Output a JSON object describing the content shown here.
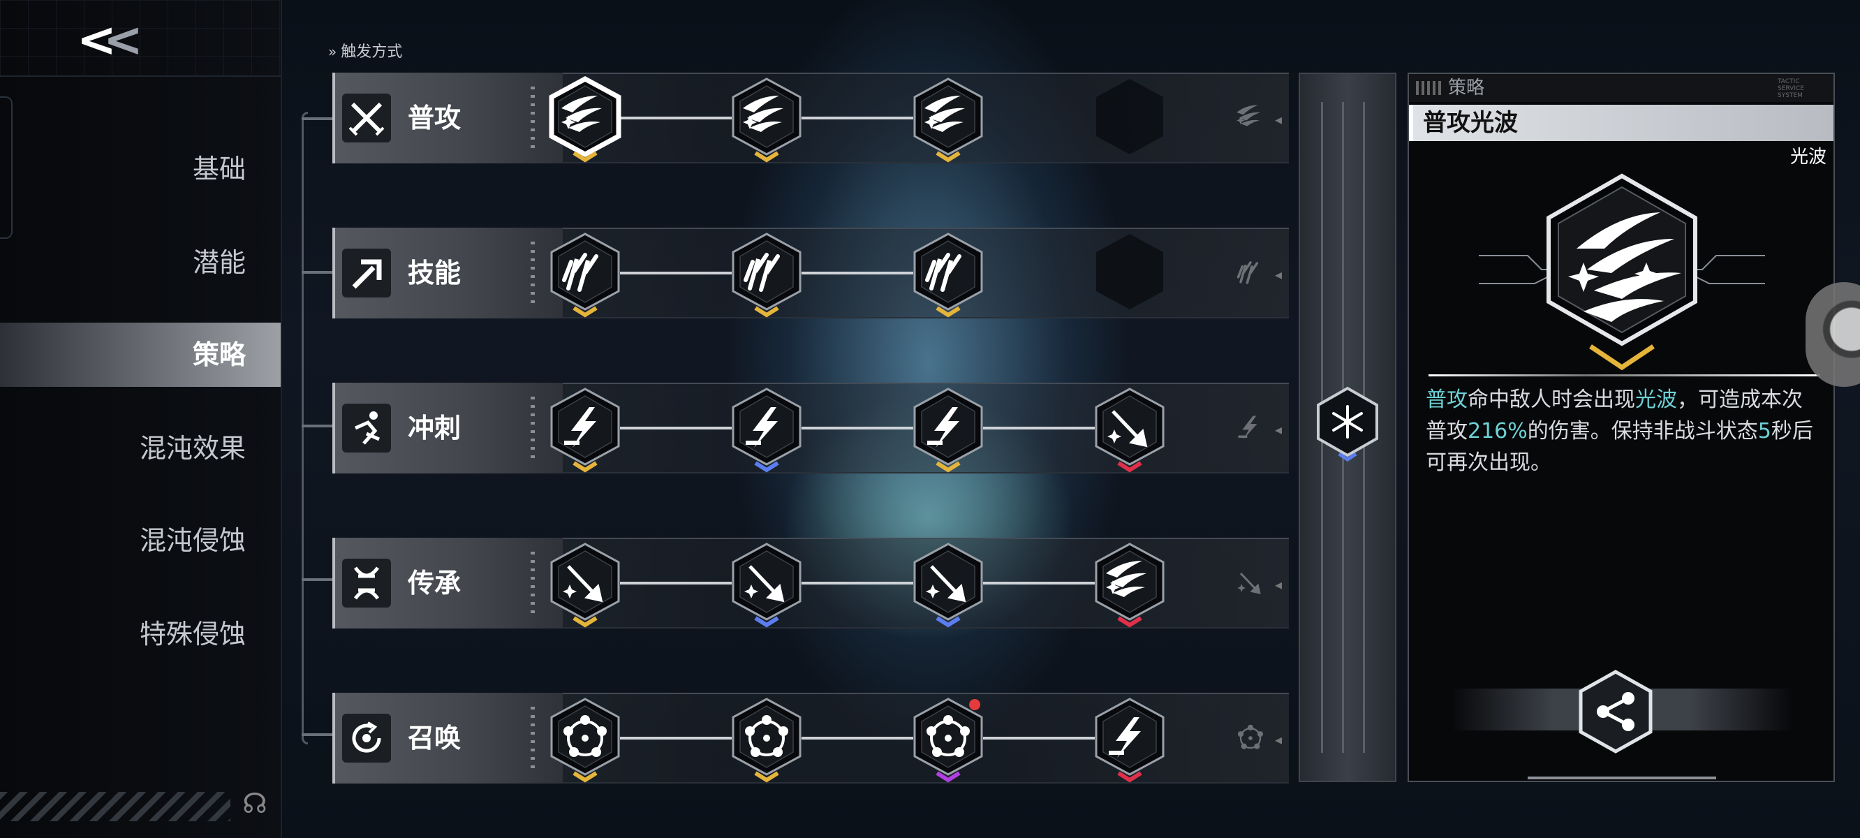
{
  "sidebar": {
    "back_label": "<<",
    "items": [
      {
        "label": "基础",
        "active": false
      },
      {
        "label": "潜能",
        "active": false
      },
      {
        "label": "策略",
        "active": true
      },
      {
        "label": "混沌效果",
        "active": false
      },
      {
        "label": "混沌侵蚀",
        "active": false
      },
      {
        "label": "特殊侵蚀",
        "active": false
      }
    ]
  },
  "header": {
    "trigger_label": "触发方式"
  },
  "rows": [
    {
      "label": "普攻",
      "icon": "crossed-swords-icon",
      "nodes": [
        {
          "icon": "wave-burst-icon",
          "rarity": "#e5b43a",
          "selected": true
        },
        {
          "icon": "wave-burst-up-icon",
          "rarity": "#e5b43a"
        },
        {
          "icon": "wave-burst-clock-icon",
          "rarity": "#e5b43a"
        },
        {
          "icon": "empty-slot",
          "rarity": ""
        }
      ]
    },
    {
      "label": "技能",
      "icon": "skill-arrow-icon",
      "nodes": [
        {
          "icon": "claw-slash-icon",
          "rarity": "#e5b43a"
        },
        {
          "icon": "claw-slash-flower-icon",
          "rarity": "#e5b43a"
        },
        {
          "icon": "claw-slash-gear-icon",
          "rarity": "#e5b43a"
        },
        {
          "icon": "empty-slot",
          "rarity": ""
        }
      ]
    },
    {
      "label": "冲刺",
      "icon": "dash-runner-icon",
      "nodes": [
        {
          "icon": "lightning-dash-icon",
          "rarity": "#e5b43a"
        },
        {
          "icon": "lightning-dash-spark-icon",
          "rarity": "#5c7df0"
        },
        {
          "icon": "lightning-dash-icon",
          "rarity": "#e5b43a"
        },
        {
          "icon": "spear-strike-icon",
          "rarity": "#e0304a"
        }
      ]
    },
    {
      "label": "传承",
      "icon": "dna-helix-icon",
      "nodes": [
        {
          "icon": "spear-star-icon",
          "rarity": "#e5b43a"
        },
        {
          "icon": "spear-spark-icon",
          "rarity": "#5c7df0"
        },
        {
          "icon": "spear-plus-icon",
          "rarity": "#5c7df0"
        },
        {
          "icon": "wave-burst-icon",
          "rarity": "#e0304a"
        }
      ]
    },
    {
      "label": "召唤",
      "icon": "summon-circle-icon",
      "nodes": [
        {
          "icon": "ring-orb-icon",
          "rarity": "#e5b43a"
        },
        {
          "icon": "ring-orb-icon",
          "rarity": "#e5b43a"
        },
        {
          "icon": "ring-orb-plus-icon",
          "rarity": "#b040e0",
          "badge": true
        },
        {
          "icon": "lightning-dash-icon",
          "rarity": "#e0304a"
        }
      ]
    }
  ],
  "middle_node": {
    "icon": "snowflake-icon",
    "rarity": "#5c7df0"
  },
  "panel": {
    "tag": "策略",
    "tag_small": "TACTIC SERVICE SYSTEM",
    "title": "普攻光波",
    "subtitle": "光波",
    "icon": "wave-burst-icon",
    "description": {
      "t1": "普攻",
      "t2": "命中敌人时会出现",
      "t3": "光波",
      "t4": "，可造成本次普攻",
      "t5": "216%",
      "t6": "的伤害。保持非战斗状态",
      "t7": "5",
      "t8": "秒后可再次出现。"
    },
    "share_icon": "share-icon"
  },
  "colors": {
    "accent": "#6ed2d6",
    "gold": "#e5b43a",
    "blue": "#5c7df0",
    "red": "#e0304a",
    "purple": "#b040e0"
  }
}
